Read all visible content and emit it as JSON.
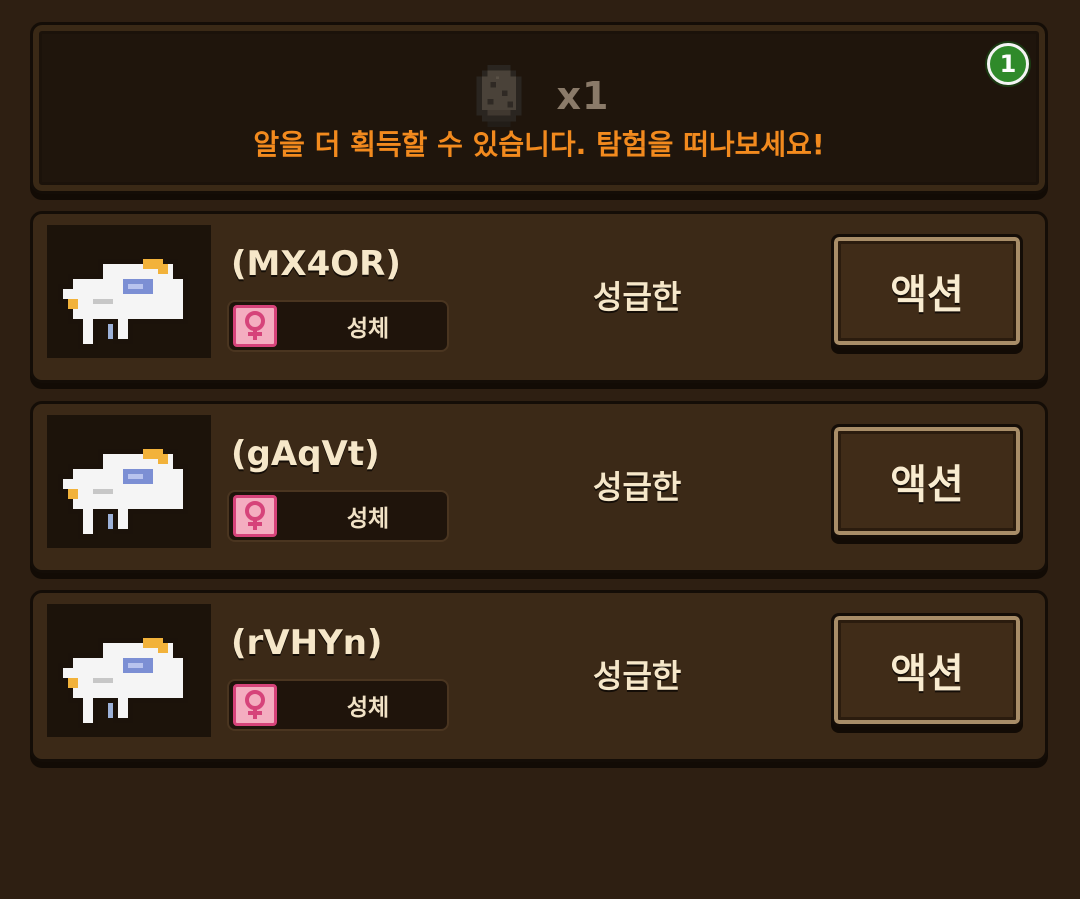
{
  "egg_panel": {
    "count": "x1",
    "message": "알을 더 획득할 수 있습니다. 탐험을 떠나보세요!",
    "badge": "1",
    "egg_icon": "egg-icon"
  },
  "creatures": [
    {
      "name": "(MX4OR)",
      "type": "성체",
      "temperament": "성급한",
      "action": "액션",
      "gender": "female"
    },
    {
      "name": "(gAqVt)",
      "type": "성체",
      "temperament": "성급한",
      "action": "액션",
      "gender": "female"
    },
    {
      "name": "(rVHYn)",
      "type": "성체",
      "temperament": "성급한",
      "action": "액션",
      "gender": "female"
    }
  ],
  "colors": {
    "background": "#2e1f12",
    "message": "#f28a1e",
    "badge": "#2f8a2a",
    "gender_female": "#d6437a"
  }
}
